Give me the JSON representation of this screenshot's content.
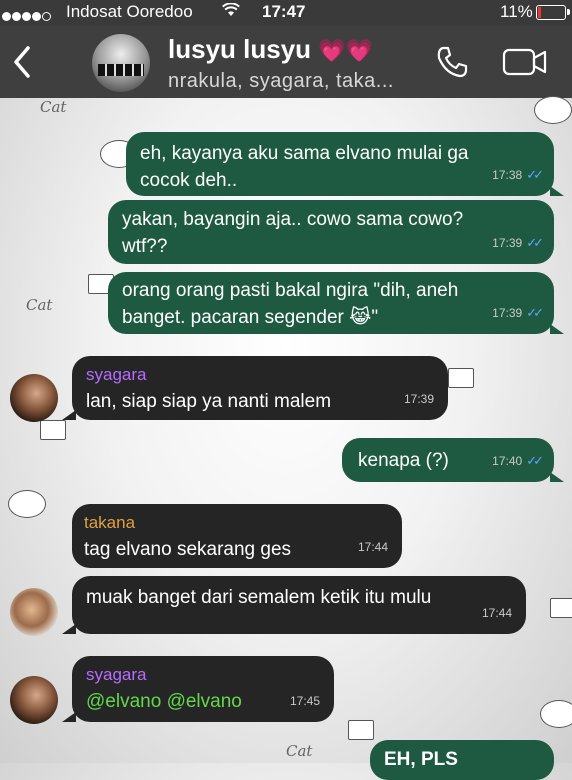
{
  "status_bar": {
    "carrier": "Indosat Ooredoo",
    "time": "17:47",
    "battery": "11%",
    "signal_dots_filled": 4,
    "signal_dots_total": 5
  },
  "header": {
    "title": "lusyu lusyu",
    "title_emoji": "💗💗",
    "subtitle": "nrakula, syagara, taka...",
    "icons": [
      "back-chevron-icon",
      "phone-icon",
      "video-camera-icon"
    ]
  },
  "messages": [
    {
      "dir": "out",
      "text": "eh, kayanya aku sama elvano mulai ga cocok deh..",
      "time": "17:38",
      "ticks": "✓✓"
    },
    {
      "dir": "out",
      "text": "yakan, bayangin aja.. cowo sama cowo? wtf??",
      "time": "17:39",
      "ticks": "✓✓"
    },
    {
      "dir": "out",
      "text": "orang orang pasti bakal ngira \"dih, aneh banget. pacaran segender 😹\"",
      "time": "17:39",
      "ticks": "✓✓"
    },
    {
      "dir": "in",
      "sender": "syagara",
      "text": "lan, siap siap ya nanti malem",
      "time": "17:39"
    },
    {
      "dir": "out",
      "text": "kenapa (?)",
      "time": "17:40",
      "ticks": "✓✓"
    },
    {
      "dir": "in",
      "sender": "takana",
      "text": "tag elvano sekarang ges",
      "time": "17:44"
    },
    {
      "dir": "in",
      "text": "muak banget dari semalem ketik itu mulu",
      "time": "17:44"
    },
    {
      "dir": "in",
      "sender": "syagara",
      "mention1": "@elvano",
      "mention2": "@elvano",
      "time": "17:45"
    },
    {
      "dir": "out",
      "text": "EH, PLS"
    }
  ],
  "colors": {
    "outgoing_bubble": "#1e5a41",
    "incoming_bubble": "#252525",
    "sender_syagara": "#b86cff",
    "sender_takana": "#e0a040",
    "mention": "#62d84b",
    "read_ticks": "#5aa6ff"
  },
  "doodles": {
    "cat1": "Cat",
    "cat2": "Cat",
    "cat3": "Cat"
  }
}
